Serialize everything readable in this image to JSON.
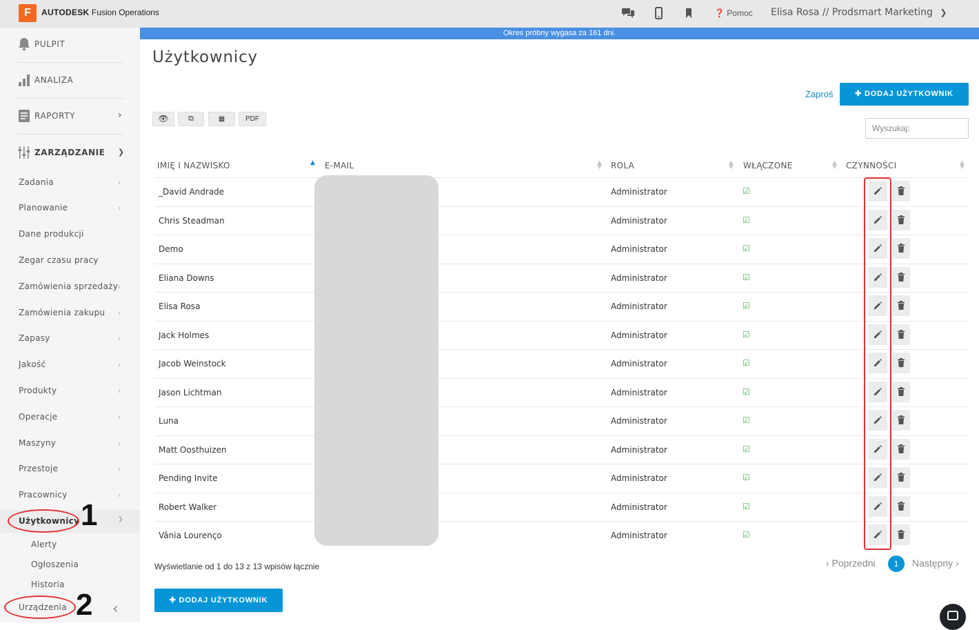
{
  "app": {
    "logo_letter": "F",
    "brand_bold": "AUTODESK",
    "brand_rest": " Fusion Operations",
    "help_label": "Pomoc",
    "user_label": "Elisa Rosa // Prodsmart Marketing",
    "trial_banner": "Okres próbny wygasa za 161 dni."
  },
  "sidebar": {
    "main": [
      {
        "label": "PULPIT",
        "icon": "bell-icon"
      },
      {
        "label": "ANALIZA",
        "icon": "bar-chart-icon"
      },
      {
        "label": "RAPORTY",
        "icon": "report-icon"
      },
      {
        "label": "ZARZĄDZANIE",
        "icon": "sliders-icon"
      }
    ],
    "sub": [
      "Zadania",
      "Planowanie",
      "Dane produkcji",
      "Zegar czasu pracy",
      "Zamówienia sprzedaży",
      "Zamówienia zakupu",
      "Zapasy",
      "Jakość",
      "Produkty",
      "Operacje",
      "Maszyny",
      "Przestoje",
      "Pracownicy",
      "Użytkownicy"
    ],
    "users_children": [
      "Alerty",
      "Ogłoszenia",
      "Historia"
    ],
    "devices": "Urządzenia",
    "annotation_1": "1",
    "annotation_2": "2"
  },
  "page": {
    "title": "Użytkownicy",
    "invite_label": "Zaproś",
    "add_user_label": "✚ DODAJ UŻYTKOWNIK",
    "toolbar": {
      "pdf_label": "PDF"
    },
    "search_placeholder": "Wyszukaj:",
    "columns": [
      "IMIĘ I NAZWISKO",
      "E-MAIL",
      "ROLA",
      "WŁĄCZONE",
      "CZYNNOŚCI"
    ],
    "rows": [
      {
        "name": "_David Andrade",
        "role": "Administrator",
        "enabled": true
      },
      {
        "name": "Chris Steadman",
        "role": "Administrator",
        "enabled": true
      },
      {
        "name": "Demo",
        "role": "Administrator",
        "enabled": true
      },
      {
        "name": "Eliana Downs",
        "role": "Administrator",
        "enabled": true
      },
      {
        "name": "Elisa Rosa",
        "role": "Administrator",
        "enabled": true
      },
      {
        "name": "Jack Holmes",
        "role": "Administrator",
        "enabled": true
      },
      {
        "name": "Jacob Weinstock",
        "role": "Administrator",
        "enabled": true
      },
      {
        "name": "Jason Lichtman",
        "role": "Administrator",
        "enabled": true
      },
      {
        "name": "Luna",
        "role": "Administrator",
        "enabled": true
      },
      {
        "name": "Matt Oosthuizen",
        "role": "Administrator",
        "enabled": true
      },
      {
        "name": "Pending Invite",
        "role": "Administrator",
        "enabled": true
      },
      {
        "name": "Robert Walker",
        "role": "Administrator",
        "enabled": true
      },
      {
        "name": "Vânia Lourenço",
        "role": "Administrator",
        "enabled": true
      }
    ],
    "info": "Wyświetlanie od 1 do 13 z 13 wpisów łącznie",
    "prev_label": "‹ Poprzedni",
    "next_label": "Następny ›",
    "current_page": "1"
  },
  "colors": {
    "accent": "#0696d7",
    "banner": "#4a90e2",
    "annotation": "#e3302f",
    "check": "#4caf50"
  }
}
